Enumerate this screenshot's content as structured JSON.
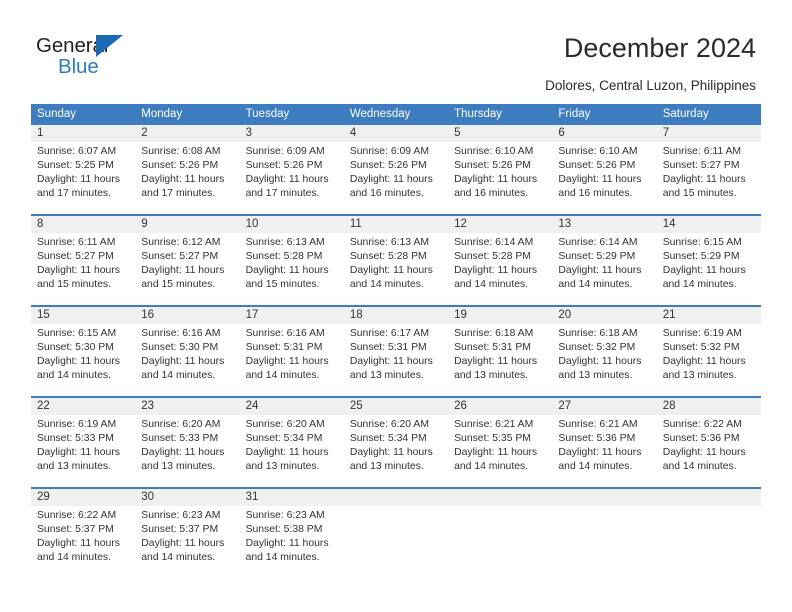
{
  "brand": {
    "name_part1": "General",
    "name_part2": "Blue",
    "triangle_color": "#1b68b3",
    "blue_text_color": "#2b7cc4"
  },
  "header": {
    "title": "December 2024",
    "subtitle": "Dolores, Central Luzon, Philippines"
  },
  "theme": {
    "header_blue": "#3c7cbf",
    "daynum_background": "#f0f0f0",
    "text_color": "#333333"
  },
  "calendar": {
    "weekday_headers": [
      "Sunday",
      "Monday",
      "Tuesday",
      "Wednesday",
      "Thursday",
      "Friday",
      "Saturday"
    ],
    "weeks": [
      {
        "days": [
          {
            "num": "1",
            "sunrise": "Sunrise: 6:07 AM",
            "sunset": "Sunset: 5:25 PM",
            "daylight1": "Daylight: 11 hours",
            "daylight2": "and 17 minutes."
          },
          {
            "num": "2",
            "sunrise": "Sunrise: 6:08 AM",
            "sunset": "Sunset: 5:26 PM",
            "daylight1": "Daylight: 11 hours",
            "daylight2": "and 17 minutes."
          },
          {
            "num": "3",
            "sunrise": "Sunrise: 6:09 AM",
            "sunset": "Sunset: 5:26 PM",
            "daylight1": "Daylight: 11 hours",
            "daylight2": "and 17 minutes."
          },
          {
            "num": "4",
            "sunrise": "Sunrise: 6:09 AM",
            "sunset": "Sunset: 5:26 PM",
            "daylight1": "Daylight: 11 hours",
            "daylight2": "and 16 minutes."
          },
          {
            "num": "5",
            "sunrise": "Sunrise: 6:10 AM",
            "sunset": "Sunset: 5:26 PM",
            "daylight1": "Daylight: 11 hours",
            "daylight2": "and 16 minutes."
          },
          {
            "num": "6",
            "sunrise": "Sunrise: 6:10 AM",
            "sunset": "Sunset: 5:26 PM",
            "daylight1": "Daylight: 11 hours",
            "daylight2": "and 16 minutes."
          },
          {
            "num": "7",
            "sunrise": "Sunrise: 6:11 AM",
            "sunset": "Sunset: 5:27 PM",
            "daylight1": "Daylight: 11 hours",
            "daylight2": "and 15 minutes."
          }
        ]
      },
      {
        "days": [
          {
            "num": "8",
            "sunrise": "Sunrise: 6:11 AM",
            "sunset": "Sunset: 5:27 PM",
            "daylight1": "Daylight: 11 hours",
            "daylight2": "and 15 minutes."
          },
          {
            "num": "9",
            "sunrise": "Sunrise: 6:12 AM",
            "sunset": "Sunset: 5:27 PM",
            "daylight1": "Daylight: 11 hours",
            "daylight2": "and 15 minutes."
          },
          {
            "num": "10",
            "sunrise": "Sunrise: 6:13 AM",
            "sunset": "Sunset: 5:28 PM",
            "daylight1": "Daylight: 11 hours",
            "daylight2": "and 15 minutes."
          },
          {
            "num": "11",
            "sunrise": "Sunrise: 6:13 AM",
            "sunset": "Sunset: 5:28 PM",
            "daylight1": "Daylight: 11 hours",
            "daylight2": "and 14 minutes."
          },
          {
            "num": "12",
            "sunrise": "Sunrise: 6:14 AM",
            "sunset": "Sunset: 5:28 PM",
            "daylight1": "Daylight: 11 hours",
            "daylight2": "and 14 minutes."
          },
          {
            "num": "13",
            "sunrise": "Sunrise: 6:14 AM",
            "sunset": "Sunset: 5:29 PM",
            "daylight1": "Daylight: 11 hours",
            "daylight2": "and 14 minutes."
          },
          {
            "num": "14",
            "sunrise": "Sunrise: 6:15 AM",
            "sunset": "Sunset: 5:29 PM",
            "daylight1": "Daylight: 11 hours",
            "daylight2": "and 14 minutes."
          }
        ]
      },
      {
        "days": [
          {
            "num": "15",
            "sunrise": "Sunrise: 6:15 AM",
            "sunset": "Sunset: 5:30 PM",
            "daylight1": "Daylight: 11 hours",
            "daylight2": "and 14 minutes."
          },
          {
            "num": "16",
            "sunrise": "Sunrise: 6:16 AM",
            "sunset": "Sunset: 5:30 PM",
            "daylight1": "Daylight: 11 hours",
            "daylight2": "and 14 minutes."
          },
          {
            "num": "17",
            "sunrise": "Sunrise: 6:16 AM",
            "sunset": "Sunset: 5:31 PM",
            "daylight1": "Daylight: 11 hours",
            "daylight2": "and 14 minutes."
          },
          {
            "num": "18",
            "sunrise": "Sunrise: 6:17 AM",
            "sunset": "Sunset: 5:31 PM",
            "daylight1": "Daylight: 11 hours",
            "daylight2": "and 13 minutes."
          },
          {
            "num": "19",
            "sunrise": "Sunrise: 6:18 AM",
            "sunset": "Sunset: 5:31 PM",
            "daylight1": "Daylight: 11 hours",
            "daylight2": "and 13 minutes."
          },
          {
            "num": "20",
            "sunrise": "Sunrise: 6:18 AM",
            "sunset": "Sunset: 5:32 PM",
            "daylight1": "Daylight: 11 hours",
            "daylight2": "and 13 minutes."
          },
          {
            "num": "21",
            "sunrise": "Sunrise: 6:19 AM",
            "sunset": "Sunset: 5:32 PM",
            "daylight1": "Daylight: 11 hours",
            "daylight2": "and 13 minutes."
          }
        ]
      },
      {
        "days": [
          {
            "num": "22",
            "sunrise": "Sunrise: 6:19 AM",
            "sunset": "Sunset: 5:33 PM",
            "daylight1": "Daylight: 11 hours",
            "daylight2": "and 13 minutes."
          },
          {
            "num": "23",
            "sunrise": "Sunrise: 6:20 AM",
            "sunset": "Sunset: 5:33 PM",
            "daylight1": "Daylight: 11 hours",
            "daylight2": "and 13 minutes."
          },
          {
            "num": "24",
            "sunrise": "Sunrise: 6:20 AM",
            "sunset": "Sunset: 5:34 PM",
            "daylight1": "Daylight: 11 hours",
            "daylight2": "and 13 minutes."
          },
          {
            "num": "25",
            "sunrise": "Sunrise: 6:20 AM",
            "sunset": "Sunset: 5:34 PM",
            "daylight1": "Daylight: 11 hours",
            "daylight2": "and 13 minutes."
          },
          {
            "num": "26",
            "sunrise": "Sunrise: 6:21 AM",
            "sunset": "Sunset: 5:35 PM",
            "daylight1": "Daylight: 11 hours",
            "daylight2": "and 14 minutes."
          },
          {
            "num": "27",
            "sunrise": "Sunrise: 6:21 AM",
            "sunset": "Sunset: 5:36 PM",
            "daylight1": "Daylight: 11 hours",
            "daylight2": "and 14 minutes."
          },
          {
            "num": "28",
            "sunrise": "Sunrise: 6:22 AM",
            "sunset": "Sunset: 5:36 PM",
            "daylight1": "Daylight: 11 hours",
            "daylight2": "and 14 minutes."
          }
        ]
      },
      {
        "days": [
          {
            "num": "29",
            "sunrise": "Sunrise: 6:22 AM",
            "sunset": "Sunset: 5:37 PM",
            "daylight1": "Daylight: 11 hours",
            "daylight2": "and 14 minutes."
          },
          {
            "num": "30",
            "sunrise": "Sunrise: 6:23 AM",
            "sunset": "Sunset: 5:37 PM",
            "daylight1": "Daylight: 11 hours",
            "daylight2": "and 14 minutes."
          },
          {
            "num": "31",
            "sunrise": "Sunrise: 6:23 AM",
            "sunset": "Sunset: 5:38 PM",
            "daylight1": "Daylight: 11 hours",
            "daylight2": "and 14 minutes."
          },
          {
            "num": "",
            "sunrise": "",
            "sunset": "",
            "daylight1": "",
            "daylight2": ""
          },
          {
            "num": "",
            "sunrise": "",
            "sunset": "",
            "daylight1": "",
            "daylight2": ""
          },
          {
            "num": "",
            "sunrise": "",
            "sunset": "",
            "daylight1": "",
            "daylight2": ""
          },
          {
            "num": "",
            "sunrise": "",
            "sunset": "",
            "daylight1": "",
            "daylight2": ""
          }
        ]
      }
    ]
  }
}
